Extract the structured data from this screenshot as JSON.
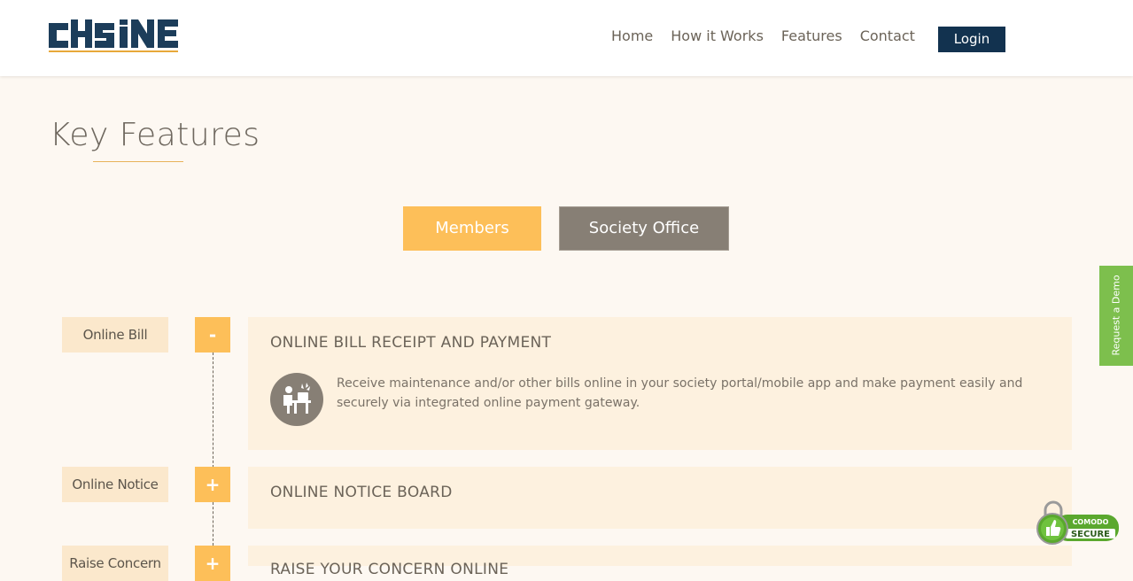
{
  "header": {
    "logo_text": "CHS ONE",
    "nav": [
      "Home",
      "How it Works",
      "Features",
      "Contact"
    ],
    "login_label": "Login"
  },
  "main": {
    "title": "Key Features",
    "tabs": [
      {
        "label": "Members",
        "active": true
      },
      {
        "label": "Society Office",
        "active": false
      }
    ],
    "features": [
      {
        "label": "Online Bill",
        "toggle": "-",
        "expanded": true,
        "title": "ONLINE BILL RECEIPT AND PAYMENT",
        "icon": "person-at-desk-icon",
        "description": "Receive maintenance and/or other bills online in your society portal/mobile app and make payment easily and securely via integrated online payment gateway."
      },
      {
        "label": "Online Notice",
        "toggle": "+",
        "expanded": false,
        "title": "ONLINE NOTICE BOARD"
      },
      {
        "label": "Raise Concern",
        "toggle": "+",
        "expanded": false,
        "title": "RAISE YOUR CONCERN ONLINE"
      }
    ]
  },
  "side": {
    "demo_label": "Request a Demo",
    "secure_badge": {
      "line1": "COMODO",
      "line2": "SECURE"
    }
  },
  "colors": {
    "background": "#fdf8f2",
    "accent": "#fdbf59",
    "navy": "#12324f",
    "muted": "#877f75",
    "panel": "#fdf1df",
    "demo": "#7dbf4d"
  }
}
